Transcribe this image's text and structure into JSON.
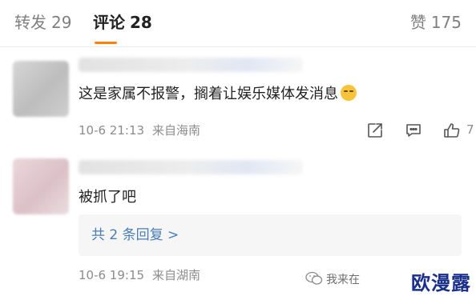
{
  "tabs": {
    "repost": {
      "label": "转发",
      "count": "29"
    },
    "comment": {
      "label": "评论",
      "count": "28"
    },
    "like": {
      "label": "赞",
      "count": "175"
    }
  },
  "comments": [
    {
      "text": "这是家属不报警，搁着让娱乐媒体发消息",
      "emoji": "sweat-smile-emoji",
      "date": "10-6 21:13",
      "location": "来自海南",
      "like_count": "7"
    },
    {
      "text": "被抓了吧",
      "replies_link": "共 2 条回复 >",
      "date": "10-6 19:15",
      "location": "来自湖南"
    }
  ],
  "watermark": {
    "small": "我来在",
    "big": "欧漫露"
  },
  "icons": {
    "share": "share-icon",
    "reply": "comment-icon",
    "like": "thumbs-up-icon",
    "watermark": "wechat-icon"
  },
  "colors": {
    "accent": "#ff8200",
    "link": "#4a7db7",
    "watermark": "#1a2f8a"
  }
}
